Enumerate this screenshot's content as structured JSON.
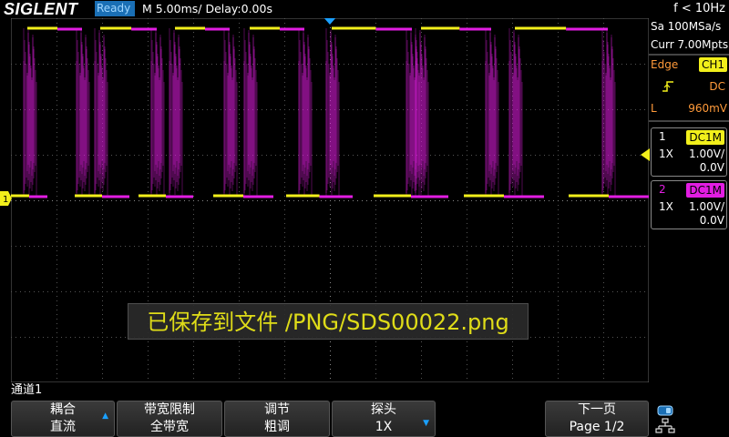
{
  "topbar": {
    "logo": "SIGLENT",
    "status": "Ready",
    "timebase": "M 5.00ms/ Delay:0.00s",
    "frequency": "f < 10Hz"
  },
  "right_panel": {
    "sample_rate": "Sa 100MSa/s",
    "memory_depth": "Curr 7.00Mpts",
    "trigger_type": "Edge",
    "trigger_source": "CH1",
    "trigger_coupling": "DC",
    "trigger_level_label": "L",
    "trigger_level": "960mV",
    "ch1": {
      "num": "1",
      "coupling": "DC1M",
      "probe": "1X",
      "scale": "1.00V/",
      "offset": "0.0V"
    },
    "ch2": {
      "num": "2",
      "coupling": "DC1M",
      "probe": "1X",
      "scale": "1.00V/",
      "offset": "0.0V"
    }
  },
  "save_message": "已保存到文件 /PNG/SDS00022.png",
  "channel_label": "通道1",
  "softkeys": [
    {
      "line1": "耦合",
      "line2": "直流"
    },
    {
      "line1": "带宽限制",
      "line2": "全带宽"
    },
    {
      "line1": "调节",
      "line2": "粗调"
    },
    {
      "line1": "探头",
      "line2": "1X"
    },
    {
      "line1": "",
      "line2": ""
    },
    {
      "line1": "下一页",
      "line2": "Page 1/2"
    }
  ],
  "markers": {
    "ch1_ground": "1"
  },
  "colors": {
    "ch1": "#f2ef1b",
    "ch2": "#e21de2",
    "status_bg": "#1a6fb5",
    "accent": "#1aa0ff",
    "trigger_text": "#ff9a3a"
  }
}
